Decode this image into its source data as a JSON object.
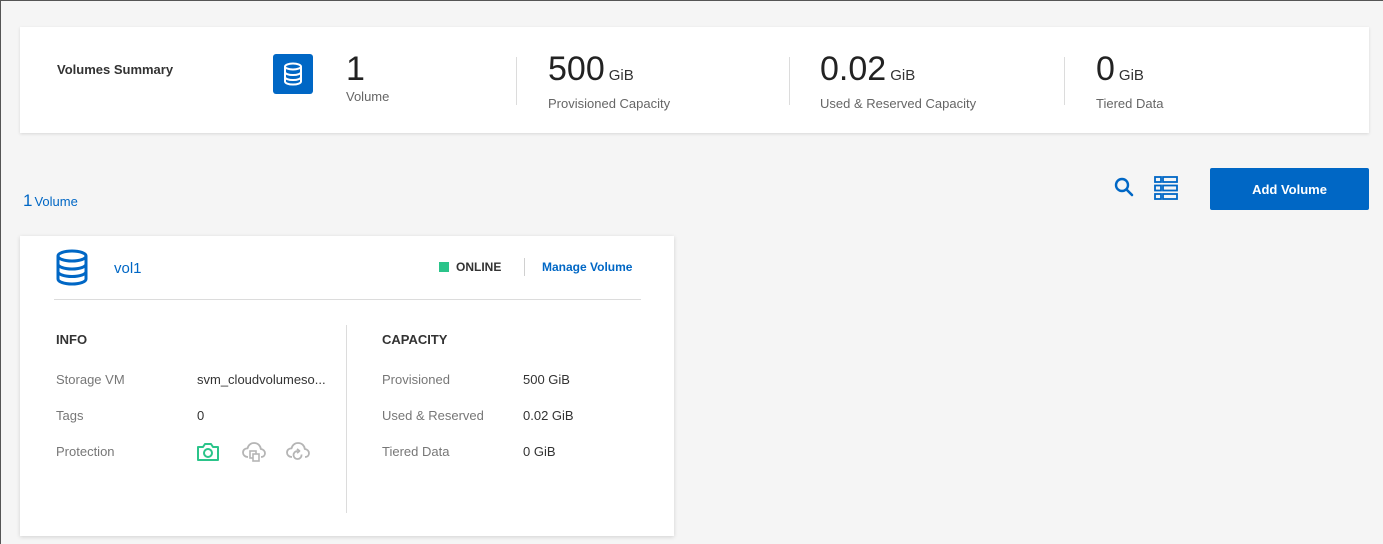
{
  "summary": {
    "title": "Volumes Summary",
    "volumes": {
      "value": "1",
      "label": "Volume"
    },
    "provisioned": {
      "value": "500",
      "unit": "GiB",
      "label": "Provisioned Capacity"
    },
    "used": {
      "value": "0.02",
      "unit": "GiB",
      "label": "Used & Reserved Capacity"
    },
    "tiered": {
      "value": "0",
      "unit": "GiB",
      "label": "Tiered Data"
    }
  },
  "list": {
    "count": "1",
    "count_label": "Volume",
    "add_button": "Add Volume"
  },
  "volume_card": {
    "name": "vol1",
    "status": "ONLINE",
    "manage_link": "Manage Volume",
    "info": {
      "title": "INFO",
      "storage_vm_label": "Storage VM",
      "storage_vm_value": "svm_cloudvolumeso...",
      "tags_label": "Tags",
      "tags_value": "0",
      "protection_label": "Protection"
    },
    "capacity": {
      "title": "CAPACITY",
      "provisioned_label": "Provisioned",
      "provisioned_value": "500 GiB",
      "used_label": "Used & Reserved",
      "used_value": "0.02 GiB",
      "tiered_label": "Tiered Data",
      "tiered_value": "0 GiB"
    }
  },
  "colors": {
    "accent": "#0067c5",
    "online": "#2bc48a",
    "protection_active": "#2bc48a",
    "protection_inactive": "#b5b5b5"
  },
  "icons": [
    "database-icon",
    "search-icon",
    "list-view-icon",
    "snapshot-icon",
    "replication-icon",
    "backup-icon"
  ]
}
